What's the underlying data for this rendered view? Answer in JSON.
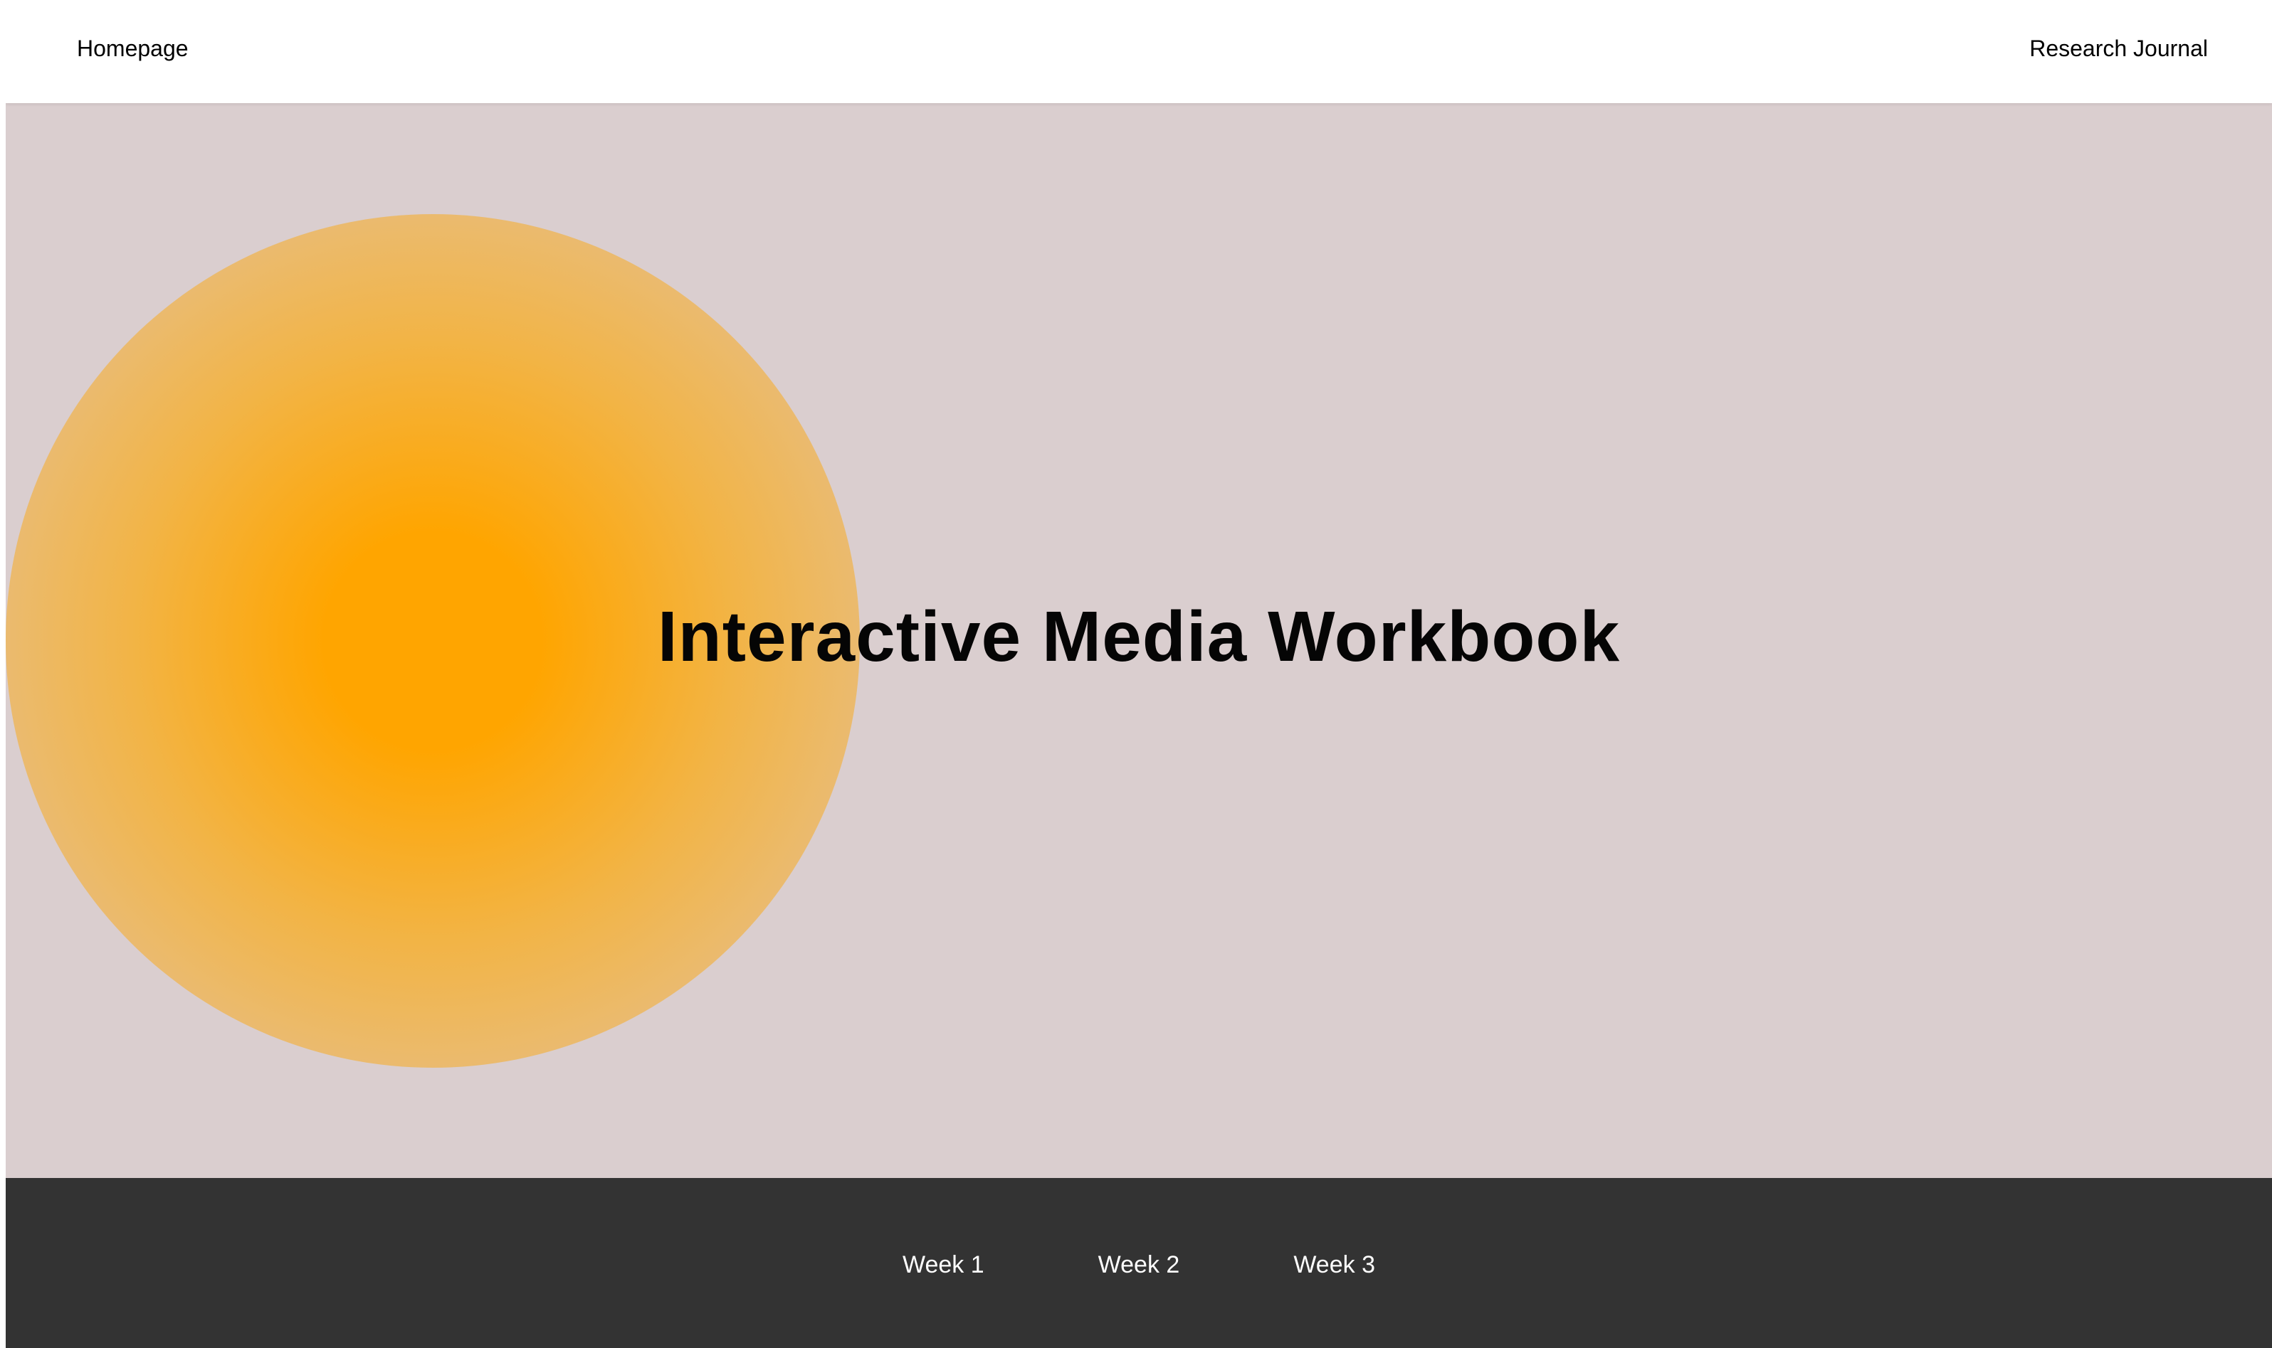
{
  "header": {
    "home_label": "Homepage",
    "journal_label": "Research Journal"
  },
  "hero": {
    "title": "Interactive Media Workbook",
    "background_color": "#dacecf",
    "orb_colors": {
      "center": "#ffa500",
      "mid": "#f2b446",
      "edge": "#e0c4a8"
    }
  },
  "footer": {
    "background_color": "#333333",
    "weeks": [
      {
        "label": "Week 1"
      },
      {
        "label": "Week 2"
      },
      {
        "label": "Week 3"
      }
    ]
  }
}
